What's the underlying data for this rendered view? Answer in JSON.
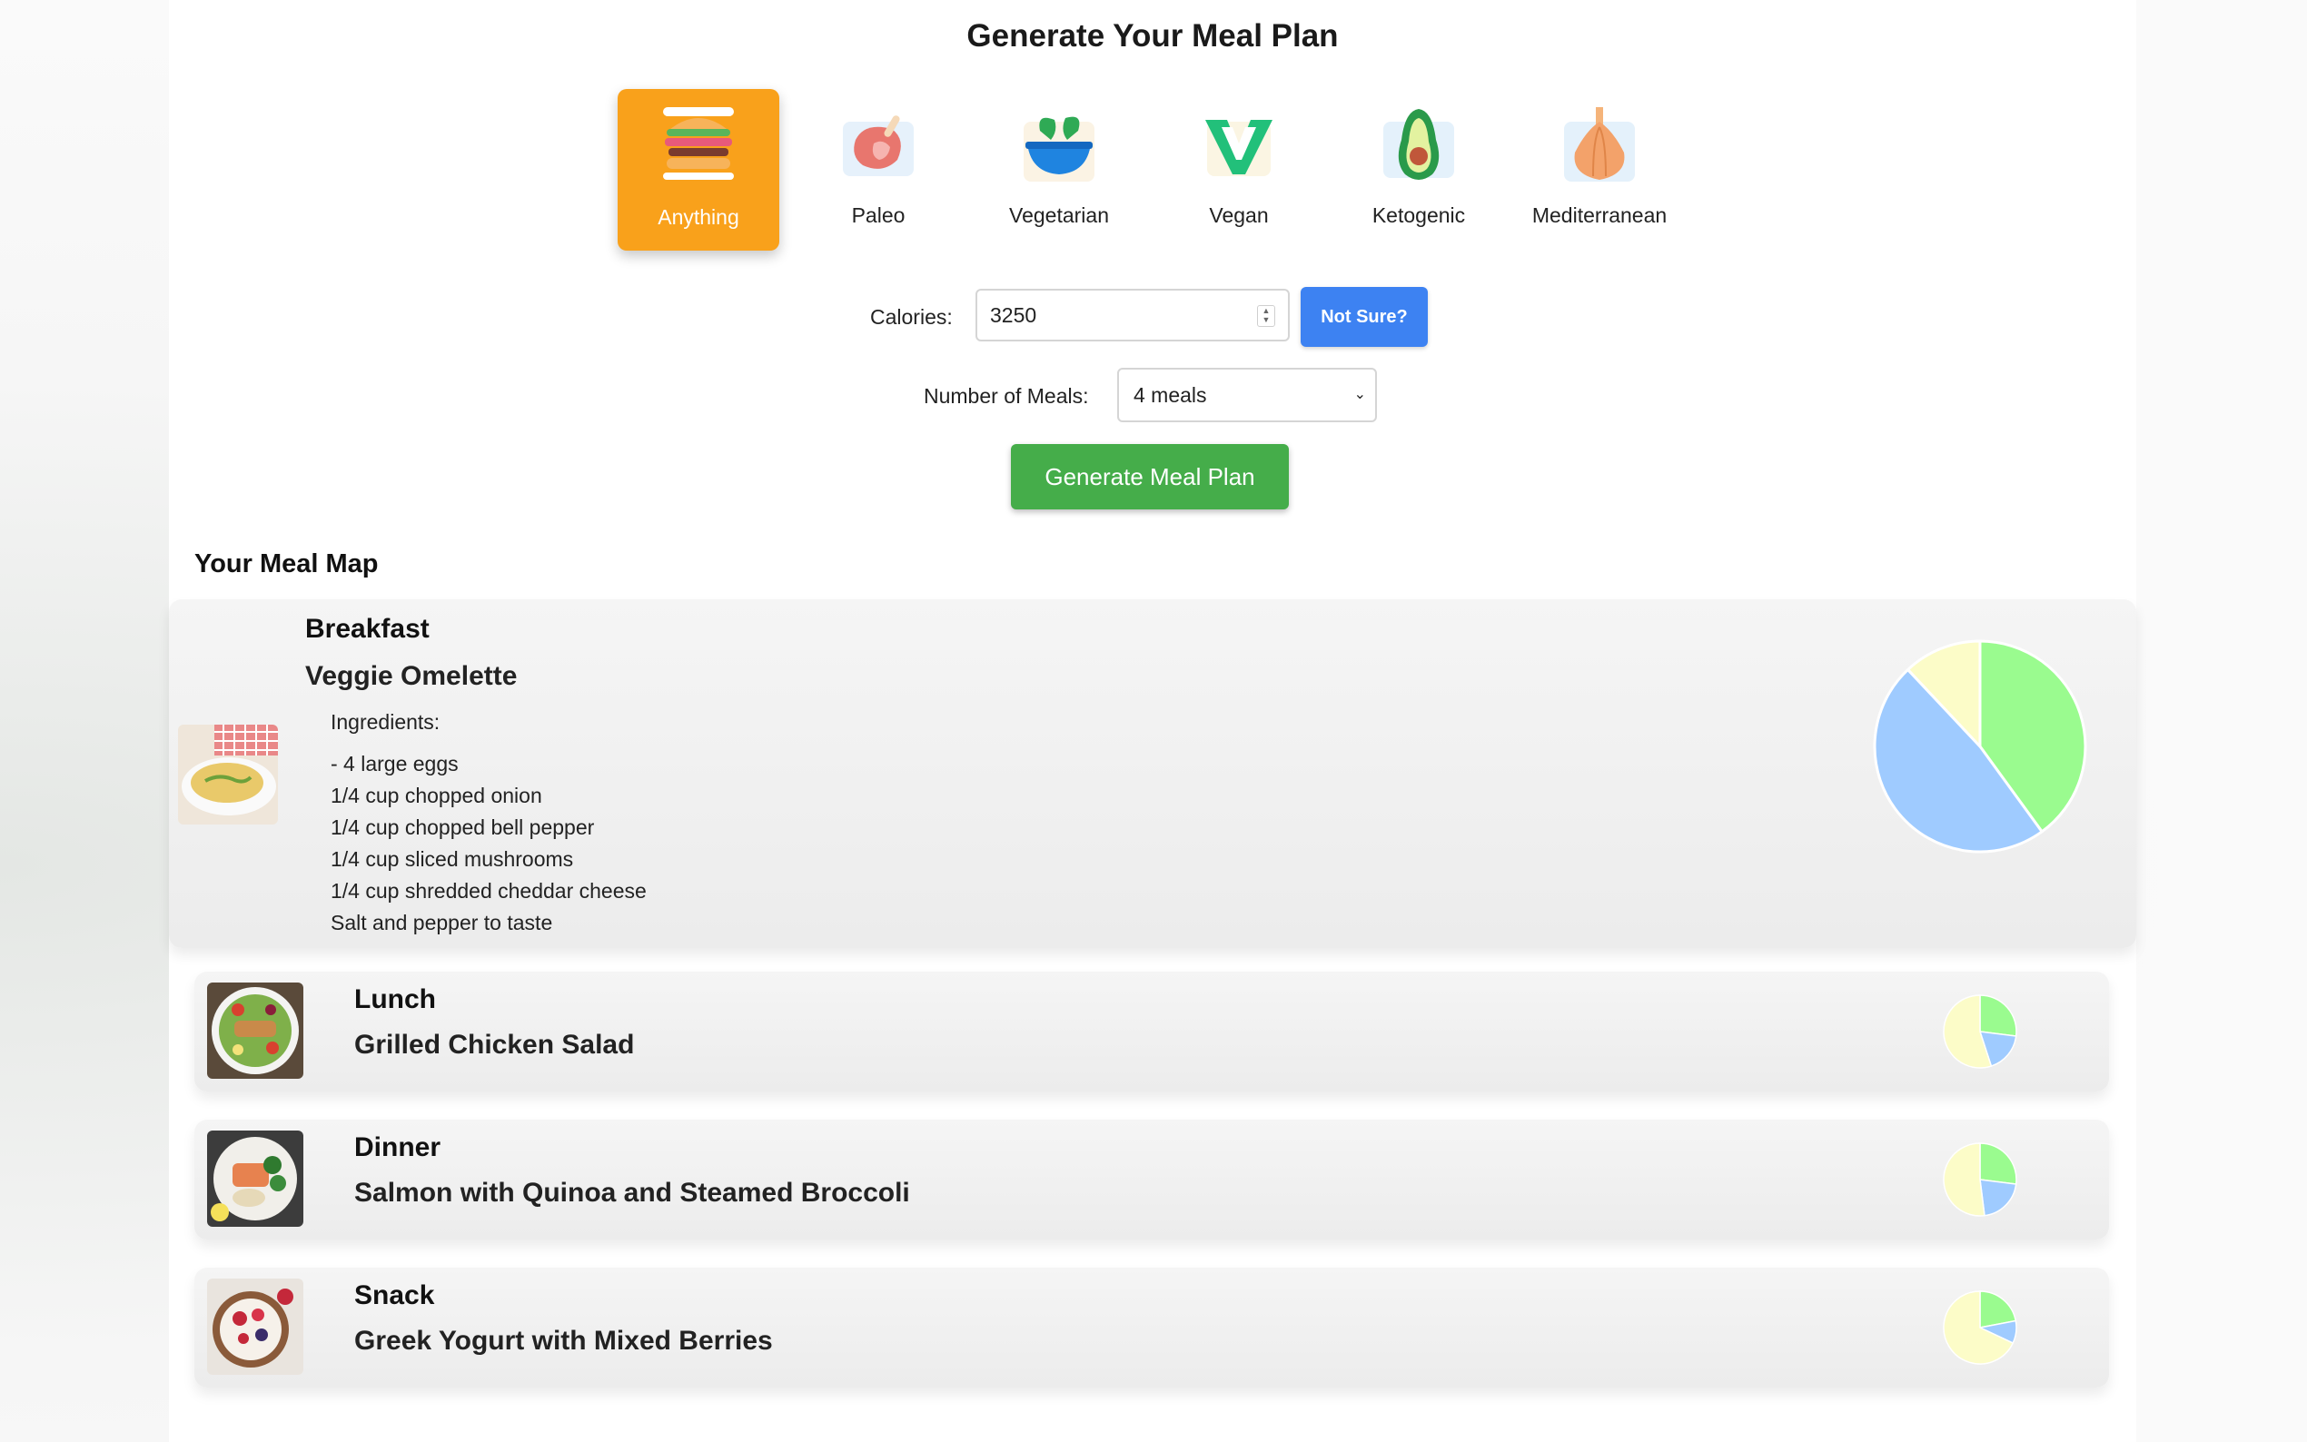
{
  "title": "Generate Your Meal Plan",
  "diets": [
    {
      "label": "Anything",
      "icon": "sandwich-icon",
      "active": true
    },
    {
      "label": "Paleo",
      "icon": "meat-icon",
      "active": false
    },
    {
      "label": "Vegetarian",
      "icon": "salad-bowl-icon",
      "active": false
    },
    {
      "label": "Vegan",
      "icon": "vegan-v-icon",
      "active": false
    },
    {
      "label": "Ketogenic",
      "icon": "avocado-icon",
      "active": false
    },
    {
      "label": "Mediterranean",
      "icon": "garlic-icon",
      "active": false
    }
  ],
  "form": {
    "calories_label": "Calories:",
    "calories_value": "3250",
    "not_sure_label": "Not Sure?",
    "meals_label": "Number of Meals:",
    "meals_value": "4 meals",
    "generate_label": "Generate Meal Plan"
  },
  "meal_map_title": "Your Meal Map",
  "colors": {
    "accent_orange": "#f9a11b",
    "button_blue": "#3d82f2",
    "button_green": "#45ad4a",
    "pie_green": "#9afb8f",
    "pie_blue": "#9fcbff",
    "pie_yellow": "#fcfcc8"
  },
  "meals": [
    {
      "type": "Breakfast",
      "name": "Veggie Omelette",
      "ingredients_title": "Ingredients:",
      "ingredients": [
        "- 4 large eggs",
        "1/4 cup chopped onion",
        "1/4 cup chopped bell pepper",
        "1/4 cup sliced mushrooms",
        "1/4 cup shredded cheddar cheese",
        "Salt and pepper to taste"
      ],
      "macros": {
        "green": 0.4,
        "blue": 0.48,
        "yellow": 0.12
      }
    },
    {
      "type": "Lunch",
      "name": "Grilled Chicken Salad",
      "macros": {
        "green": 0.27,
        "blue": 0.18,
        "yellow": 0.55
      }
    },
    {
      "type": "Dinner",
      "name": "Salmon with Quinoa and Steamed Broccoli",
      "macros": {
        "green": 0.27,
        "blue": 0.21,
        "yellow": 0.52
      }
    },
    {
      "type": "Snack",
      "name": "Greek Yogurt with Mixed Berries",
      "macros": {
        "green": 0.22,
        "blue": 0.1,
        "yellow": 0.68
      }
    }
  ]
}
